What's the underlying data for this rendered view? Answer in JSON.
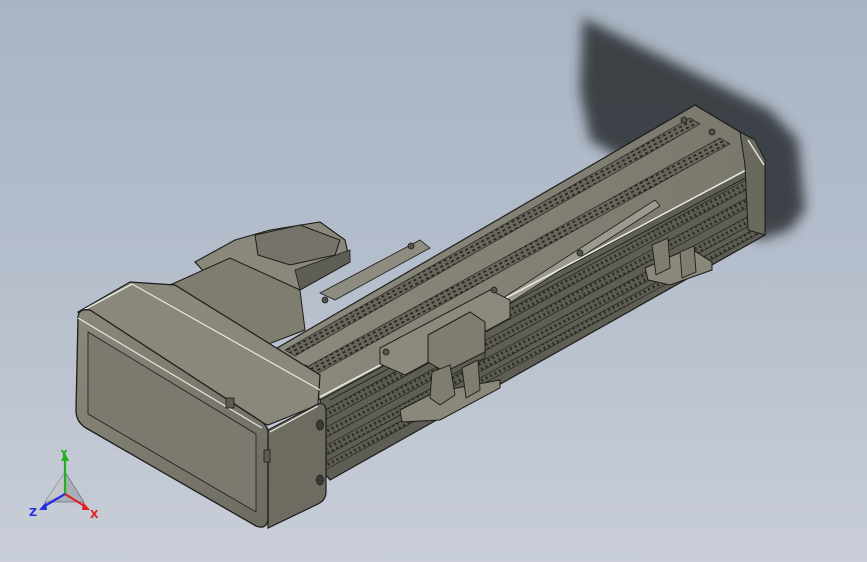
{
  "viewport": {
    "background_top": "#a9b4c3",
    "background_bottom": "#c9ced8"
  },
  "model": {
    "body_color": "#7e7c6f",
    "body_light": "#9a988b",
    "body_dark": "#5a5950",
    "edge_color": "#1c1c1a",
    "highlight": "#e8e8e4",
    "shadow_color": "#2a2d33"
  },
  "triad": {
    "x_label": "X",
    "y_label": "Y",
    "z_label": "Z",
    "x_color": "#e02020",
    "y_color": "#20b020",
    "z_color": "#2030e0"
  }
}
